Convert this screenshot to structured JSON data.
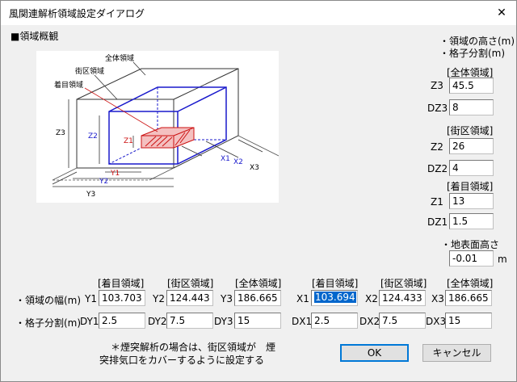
{
  "window": {
    "title": "風関連解析領域設定ダイアログ",
    "close": "✕"
  },
  "overview": {
    "heading": "■領域概観"
  },
  "right_panel": {
    "note1": "・領域の高さ(m)",
    "note2": "・格子分割(m)",
    "sections": [
      {
        "header": "[全体領域]",
        "h_label": "Z3",
        "h_value": "45.5",
        "d_label": "DZ3",
        "d_value": "8"
      },
      {
        "header": "[街区領域]",
        "h_label": "Z2",
        "h_value": "26",
        "d_label": "DZ2",
        "d_value": "4"
      },
      {
        "header": "[着目領域]",
        "h_label": "Z1",
        "h_value": "13",
        "d_label": "DZ1",
        "d_value": "1.5"
      }
    ],
    "ground_label": "・地表面高さ",
    "ground_value": "-0.01",
    "ground_unit": "m"
  },
  "diagram": {
    "labels": {
      "all": "全体領域",
      "block": "街区領域",
      "focus": "着目領域",
      "z1": "Z1",
      "z2": "Z2",
      "z3": "Z3",
      "y1": "Y1",
      "y2": "Y2",
      "y3": "Y3",
      "x1": "X1",
      "x2": "X2",
      "x3": "X3"
    }
  },
  "bottom": {
    "headers": [
      "[着目領域]",
      "[街区領域]",
      "[全体領域]",
      "[着目領域]",
      "[街区領域]",
      "[全体領域]"
    ],
    "width_row_label": "・領域の幅(m)",
    "grid_row_label": "・格子分割(m)",
    "width_row": [
      {
        "label": "Y1",
        "value": "103.703"
      },
      {
        "label": "Y2",
        "value": "124.443"
      },
      {
        "label": "Y3",
        "value": "186.665"
      },
      {
        "label": "X1",
        "value": "103.694"
      },
      {
        "label": "X2",
        "value": "124.433"
      },
      {
        "label": "X3",
        "value": "186.665"
      }
    ],
    "grid_row": [
      {
        "label": "DY1",
        "value": "2.5"
      },
      {
        "label": "DY2",
        "value": "7.5"
      },
      {
        "label": "DY3",
        "value": "15"
      },
      {
        "label": "DX1",
        "value": "2.5"
      },
      {
        "label": "DX2",
        "value": "7.5"
      },
      {
        "label": "DX3",
        "value": "15"
      }
    ],
    "note_line1": "＊煙突解析の場合は、街区領域が　煙",
    "note_line2": "突排気口をカバーするように設定する",
    "ok": "OK",
    "cancel": "キャンセル"
  }
}
